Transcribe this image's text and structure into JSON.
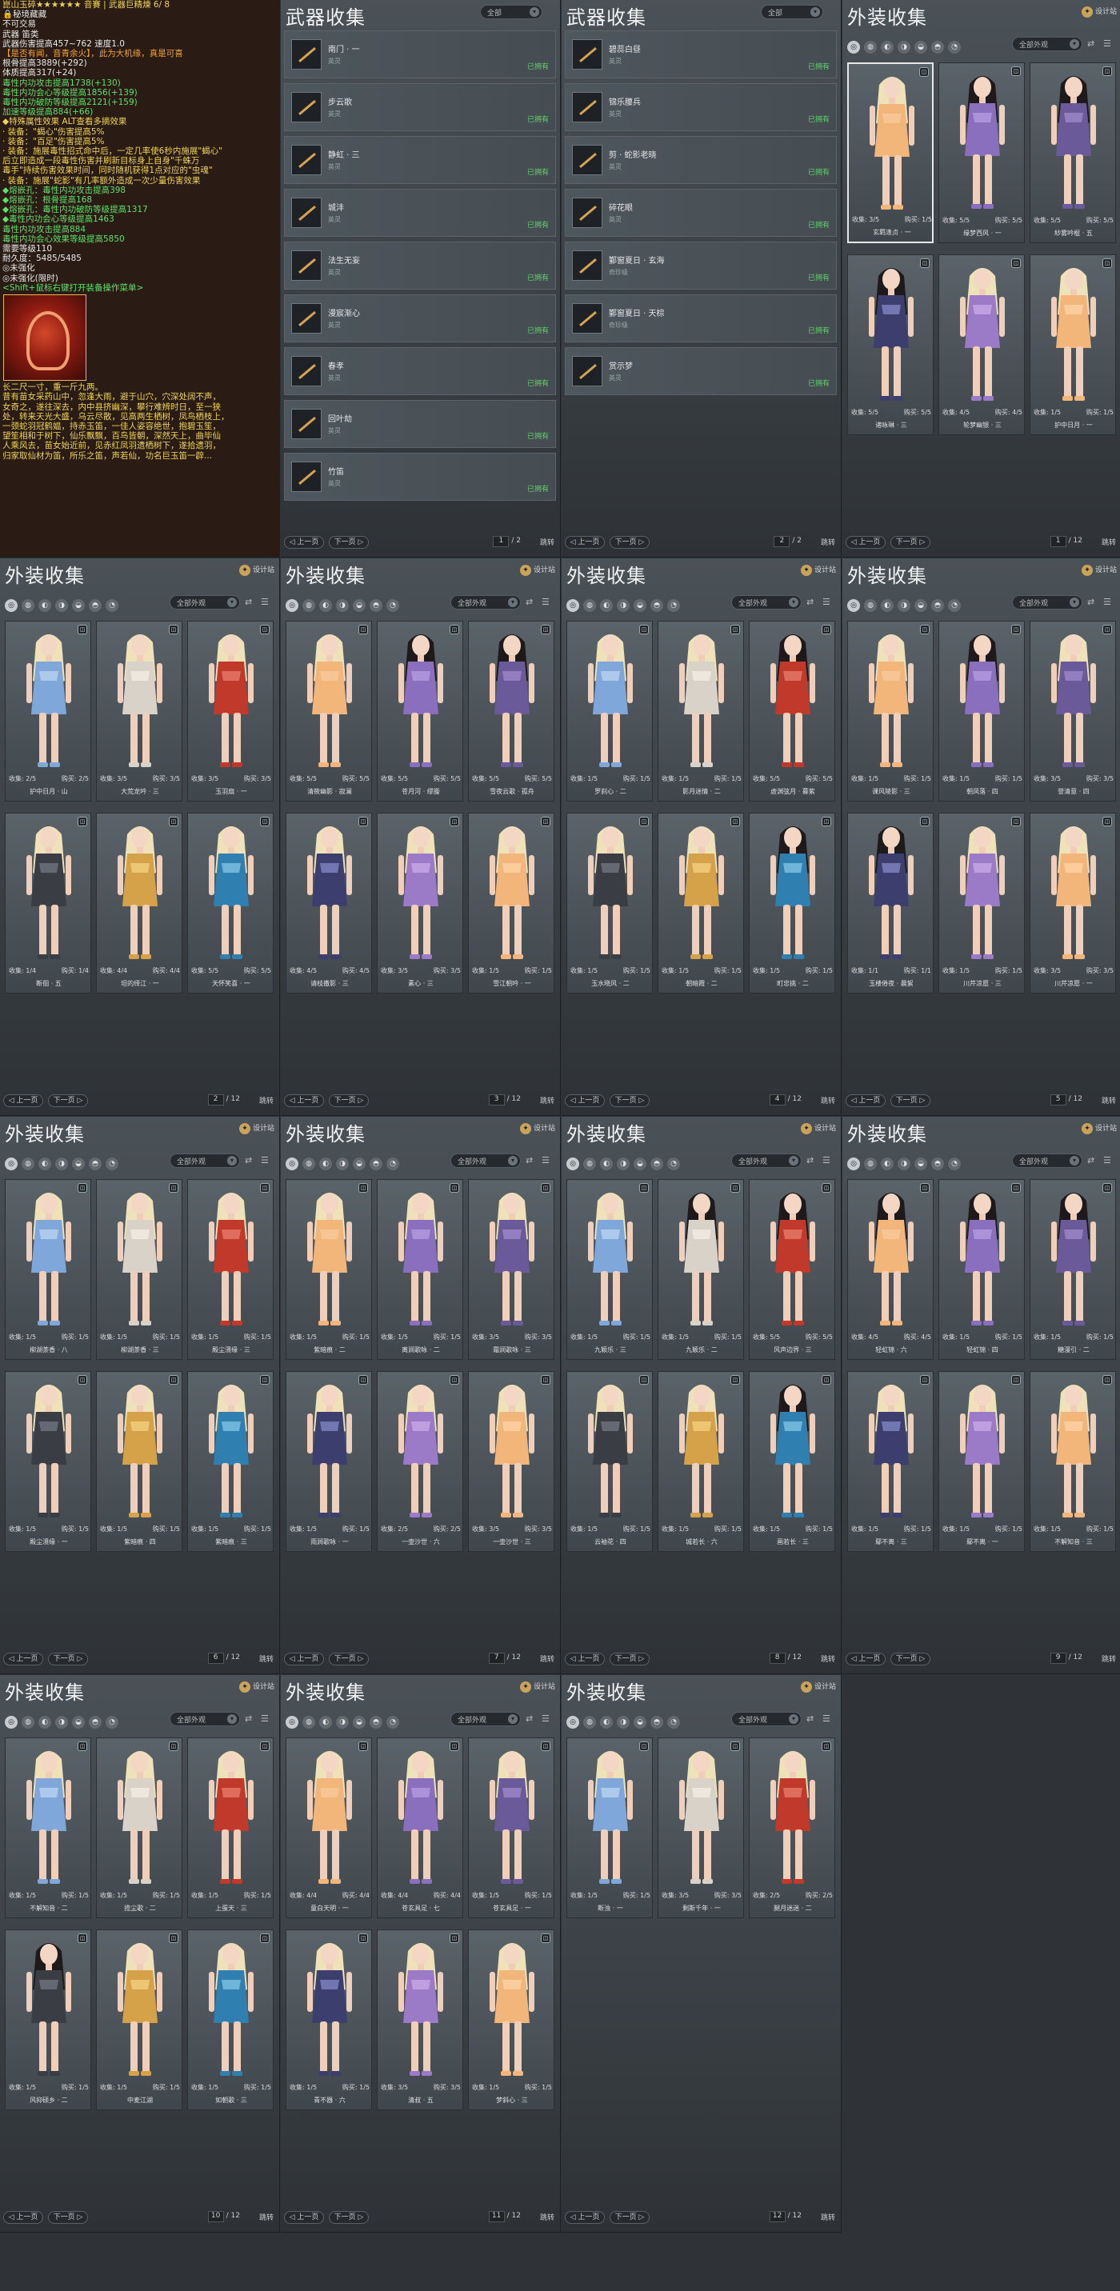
{
  "tooltip": {
    "lines": [
      {
        "t": "崑山玉碎★★★★★★ 音賽 | 武器巨精煉 6/ 8",
        "c": "y"
      },
      {
        "t": "🔒秘境藏藏",
        "c": "w"
      },
      {
        "t": "不可交易",
        "c": "w"
      },
      {
        "t": "武器                                                       笛类",
        "c": "w"
      },
      {
        "t": "武器伤害提高457~762                              速度1.0",
        "c": "w"
      },
      {
        "t": "【是否有闻，音青余火】，此为大机缘，真是可喜",
        "c": "o"
      },
      {
        "t": "根骨提高3889(+292)",
        "c": "w"
      },
      {
        "t": "体质提高317(+24)",
        "c": "w"
      },
      {
        "t": "毒性内功攻击提高1738(+130)",
        "c": "g"
      },
      {
        "t": "毒性内功会心等级提高1856(+139)",
        "c": "g"
      },
      {
        "t": "毒性内功破防等级提高2121(+159)",
        "c": "g"
      },
      {
        "t": "加速等级提高884(+66)",
        "c": "g"
      },
      {
        "t": "◆特殊属性效果                               ALT查看多摘效果",
        "c": "y"
      },
      {
        "t": "· 装备：\"蝎心\"伤害提高5%",
        "c": "y"
      },
      {
        "t": "· 装备：\"百足\"伤害提高5%",
        "c": "y"
      },
      {
        "t": "· 装备：施展毒性招式命中后，一定几率使6秒内施展\"蝎心\"",
        "c": "y"
      },
      {
        "t": "后立即造成一段毒性伤害并刷新目标身上自身\"千蛛万",
        "c": "y"
      },
      {
        "t": "毒手\"持续伤害效果时间，同时随机获得1点对应的\"虫魂\"",
        "c": "y"
      },
      {
        "t": "· 装备：施展\"蛇影\"有几率额外造成一次少量伤害效果",
        "c": "y"
      },
      {
        "t": "◆熔嵌孔：毒性内功攻击提高398",
        "c": "g"
      },
      {
        "t": "◆熔嵌孔：根骨提高168",
        "c": "g"
      },
      {
        "t": "◆熔嵌孔：毒性内功破防等级提高1317",
        "c": "g"
      },
      {
        "t": "◆毒性内功会心等级提高1463",
        "c": "g"
      },
      {
        "t": "      毒性内功攻击提高884",
        "c": "g"
      },
      {
        "t": "      毒性内功会心效果等级提高5850",
        "c": "g"
      },
      {
        "t": "需要等级110",
        "c": "w"
      },
      {
        "t": "耐久度：5485/5485",
        "c": "w"
      },
      {
        "t": "◎未强化",
        "c": "w"
      },
      {
        "t": "◎未强化(限时)",
        "c": "w"
      },
      {
        "t": "<Shift+鼠标右键打开装备操作菜单>",
        "c": "g"
      }
    ],
    "desc": [
      "长二尺一寸，重一斤九两。",
      "昔有苗女采药山中，忽逢大雨，避于山穴，穴深处阔不声，",
      "女奇之，遂往深去，内中县挤幽深，攀行难辨时日，至一狭",
      "处，转来天光大盛，乌云尽散，见高两生栖树，凤鸟栖枝上，",
      "一颈蛇羽冠鹤媪，持赤玉笛，一佳人姿容绝世，抱碧玉笙，",
      "望笙相和于树下，仙乐飘飘，百鸟皆朝，深然天上，曲毕仙",
      "人乘风去，苗女始近前，见赤红凤羽遗栖树下，遂拾遗羽，",
      "归家取仙材为笛，所乐之笛，声若仙，功名巨玉笛一辟..."
    ]
  },
  "weapon_panels": [
    {
      "title": "武器收集",
      "filter": "全部",
      "page": "1",
      "total": "2",
      "items": [
        {
          "name": "南门 · 一",
          "sub": "英灵",
          "status": "已拥有"
        },
        {
          "name": "步云歌",
          "sub": "英灵",
          "status": "已拥有"
        },
        {
          "name": "静虹 · 三",
          "sub": "英灵",
          "status": "已拥有"
        },
        {
          "name": "城沣",
          "sub": "英灵",
          "status": "已拥有"
        },
        {
          "name": "法生无妄",
          "sub": "英灵",
          "status": "已拥有"
        },
        {
          "name": "漫宸渐心",
          "sub": "英灵",
          "status": "已拥有"
        },
        {
          "name": "春孝",
          "sub": "英灵",
          "status": "已拥有"
        },
        {
          "name": "回叶劫",
          "sub": "英灵",
          "status": "已拥有"
        },
        {
          "name": "竹笛",
          "sub": "英灵",
          "status": "已拥有"
        }
      ]
    },
    {
      "title": "武器收集",
      "filter": "全部",
      "page": "2",
      "total": "2",
      "items": [
        {
          "name": "碧蕊白昼",
          "sub": "英灵",
          "status": "已拥有"
        },
        {
          "name": "锦乐腰兵",
          "sub": "英灵",
          "status": "已拥有"
        },
        {
          "name": "剪 · 蛇影老晓",
          "sub": "英灵",
          "status": "已拥有"
        },
        {
          "name": "碎花眼",
          "sub": "英灵",
          "status": "已拥有"
        },
        {
          "name": "鄞窗夏日 · 玄海",
          "sub": "奇珍级",
          "status": "已拥有"
        },
        {
          "name": "鄞窗夏日 · 天棕",
          "sub": "奇珍级",
          "status": "已拥有"
        },
        {
          "name": "赏示梦",
          "sub": "英灵",
          "status": "已拥有"
        }
      ]
    }
  ],
  "outfit_common": {
    "title": "外装收集",
    "designer": "设计站",
    "filter": "全部外观",
    "prev": "上一页",
    "next": "下一页",
    "jump": "跳转",
    "total": "12",
    "collect_label": "收集:",
    "buy_label": "购买:"
  },
  "outfit_pages": [
    {
      "page": "1",
      "cards": [
        {
          "name": "玄羁逢贞 · 一",
          "c": "3/5",
          "b": "1/5"
        },
        {
          "name": "缘梦西风 · 一",
          "c": "5/5",
          "b": "5/5"
        },
        {
          "name": "紗雾吟棍 · 五",
          "c": "5/5",
          "b": "5/5"
        },
        {
          "name": "诸咏琳 · 三",
          "c": "5/5",
          "b": "5/5"
        },
        {
          "name": "轮梦幽银 · 三",
          "c": "4/5",
          "b": "4/5"
        },
        {
          "name": "护中日月 · 一",
          "c": "1/5",
          "b": "1/5"
        }
      ]
    },
    {
      "page": "2",
      "cards": [
        {
          "name": "护中日月 · 山",
          "c": "2/5",
          "b": "2/5"
        },
        {
          "name": "大荒龙吟 · 三",
          "c": "3/5",
          "b": "3/5"
        },
        {
          "name": "玉羽扇 · 一",
          "c": "3/5",
          "b": "3/5"
        },
        {
          "name": "断徊 · 五",
          "c": "1/4",
          "b": "1/4"
        },
        {
          "name": "坦的绎江 · 一",
          "c": "4/4",
          "b": "4/4"
        },
        {
          "name": "天怀笑喜 · 一",
          "c": "5/5",
          "b": "5/5"
        }
      ]
    },
    {
      "page": "3",
      "cards": [
        {
          "name": "清筱幽影 · 寂澜",
          "c": "5/5",
          "b": "5/5"
        },
        {
          "name": "苍月河 · 缪媵",
          "c": "5/5",
          "b": "5/5"
        },
        {
          "name": "雪夜云歌 · 孤舟",
          "c": "5/5",
          "b": "5/5"
        },
        {
          "name": "请枝撒影 · 三",
          "c": "4/5",
          "b": "4/5"
        },
        {
          "name": "素心 · 三",
          "c": "3/5",
          "b": "3/5"
        },
        {
          "name": "雪江朝吟 · 一",
          "c": "1/5",
          "b": "1/5"
        }
      ]
    },
    {
      "page": "4",
      "cards": [
        {
          "name": "罗刹心 · 二",
          "c": "1/5",
          "b": "1/5"
        },
        {
          "name": "影月迷情 · 二",
          "c": "1/5",
          "b": "1/5"
        },
        {
          "name": "虚渊弦月 · 暮紫",
          "c": "5/5",
          "b": "5/5"
        },
        {
          "name": "玉水晓风 · 二",
          "c": "1/5",
          "b": "1/5"
        },
        {
          "name": "朝暗霞 · 二",
          "c": "1/5",
          "b": "1/5"
        },
        {
          "name": "町忠挑 · 二",
          "c": "1/5",
          "b": "1/5"
        }
      ]
    },
    {
      "page": "5",
      "cards": [
        {
          "name": "课风陵影 · 三",
          "c": "1/5",
          "b": "1/5"
        },
        {
          "name": "朝凤落 · 四",
          "c": "1/5",
          "b": "1/5"
        },
        {
          "name": "誉清意 · 四",
          "c": "3/5",
          "b": "3/5"
        },
        {
          "name": "玉楼倦夜 · 晨絮",
          "c": "1/1",
          "b": "1/1"
        },
        {
          "name": "川芹凉愿 · 三",
          "c": "1/5",
          "b": "1/5"
        },
        {
          "name": "川芹凉愿 · 一",
          "c": "3/5",
          "b": "3/5"
        }
      ]
    },
    {
      "page": "6",
      "cards": [
        {
          "name": "柳湖荼香 · 八",
          "c": "1/5",
          "b": "1/5"
        },
        {
          "name": "柳湖荼香 · 三",
          "c": "1/5",
          "b": "1/5"
        },
        {
          "name": "殿尘溃缘 · 三",
          "c": "1/5",
          "b": "1/5"
        },
        {
          "name": "殿尘溃缘 · 一",
          "c": "1/5",
          "b": "1/5"
        },
        {
          "name": "紫暗痕 · 四",
          "c": "1/5",
          "b": "1/5"
        },
        {
          "name": "紫暗痕 · 三",
          "c": "1/5",
          "b": "1/5"
        }
      ]
    },
    {
      "page": "7",
      "cards": [
        {
          "name": "紫暗痕 · 二",
          "c": "1/5",
          "b": "1/5"
        },
        {
          "name": "离涧歌咏 · 二",
          "c": "1/5",
          "b": "1/5"
        },
        {
          "name": "霜涧歌咏 · 三",
          "c": "3/5",
          "b": "3/5"
        },
        {
          "name": "雨涧歌咏 · 一",
          "c": "1/5",
          "b": "1/5"
        },
        {
          "name": "一壶沙世 · 六",
          "c": "2/5",
          "b": "2/5"
        },
        {
          "name": "一壶沙世 · 三",
          "c": "3/5",
          "b": "3/5"
        }
      ]
    },
    {
      "page": "8",
      "cards": [
        {
          "name": "九颖乐 · 三",
          "c": "1/5",
          "b": "1/5"
        },
        {
          "name": "九颖乐 · 二",
          "c": "1/5",
          "b": "1/5"
        },
        {
          "name": "风声边界 · 三",
          "c": "5/5",
          "b": "5/5"
        },
        {
          "name": "云袖花 · 四",
          "c": "1/5",
          "b": "1/5"
        },
        {
          "name": "城若长 · 六",
          "c": "1/5",
          "b": "1/5"
        },
        {
          "name": "画若长 · 三",
          "c": "1/5",
          "b": "1/5"
        }
      ]
    },
    {
      "page": "9",
      "cards": [
        {
          "name": "轻虹锦 · 六",
          "c": "4/5",
          "b": "4/5"
        },
        {
          "name": "轻虹锦 · 四",
          "c": "1/5",
          "b": "1/5"
        },
        {
          "name": "糖漫引 · 二",
          "c": "1/5",
          "b": "1/5"
        },
        {
          "name": "鄢不离 · 三",
          "c": "1/5",
          "b": "1/5"
        },
        {
          "name": "鄢不离 · 一",
          "c": "1/5",
          "b": "1/5"
        },
        {
          "name": "不解知音 · 三",
          "c": "1/5",
          "b": "1/5"
        }
      ]
    },
    {
      "page": "10",
      "cards": [
        {
          "name": "不解知音 · 二",
          "c": "1/5",
          "b": "1/5"
        },
        {
          "name": "揽尘歌 · 二",
          "c": "1/5",
          "b": "1/5"
        },
        {
          "name": "上蛋天 · 三",
          "c": "1/5",
          "b": "1/5"
        },
        {
          "name": "风抑硕乡 · 二",
          "c": "1/5",
          "b": "1/5"
        },
        {
          "name": "中麦江湖",
          "c": "1/5",
          "b": "1/5"
        },
        {
          "name": "如朝歌 · 三",
          "c": "1/5",
          "b": "1/5"
        }
      ]
    },
    {
      "page": "11",
      "cards": [
        {
          "name": "童白天明 · 一",
          "c": "4/4",
          "b": "4/4"
        },
        {
          "name": "苍玄具足 · 七",
          "c": "4/4",
          "b": "4/4"
        },
        {
          "name": "苍玄具足 · 一",
          "c": "1/5",
          "b": "1/5"
        },
        {
          "name": "青不器 · 六",
          "c": "1/5",
          "b": "1/5"
        },
        {
          "name": "清叔 · 五",
          "c": "3/5",
          "b": "3/5"
        },
        {
          "name": "梦斜心 · 三",
          "c": "1/5",
          "b": "1/5"
        }
      ]
    },
    {
      "page": "12",
      "cards": [
        {
          "name": "断浊 · 一",
          "c": "1/5",
          "b": "1/5"
        },
        {
          "name": "剩斯千年 · 一",
          "c": "3/5",
          "b": "3/5"
        },
        {
          "name": "腿月迷迷 · 二",
          "c": "2/5",
          "b": "2/5"
        }
      ]
    }
  ],
  "colors": {
    "accent": "#c9a35a",
    "owned": "#5fd06a",
    "panel": "#3a4045"
  }
}
